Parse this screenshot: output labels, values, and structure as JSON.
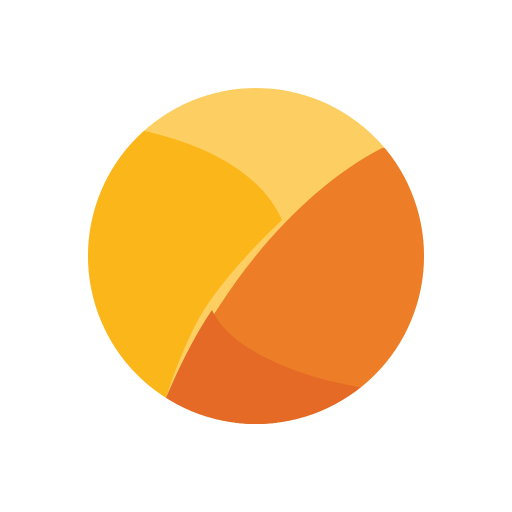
{
  "logo": {
    "icon": "orange-circle-logo-icon",
    "colors": {
      "segment_top": "#FDCF62",
      "segment_left": "#FBB61A",
      "segment_right": "#ED7D27",
      "segment_bottom": "#E46A26"
    }
  }
}
